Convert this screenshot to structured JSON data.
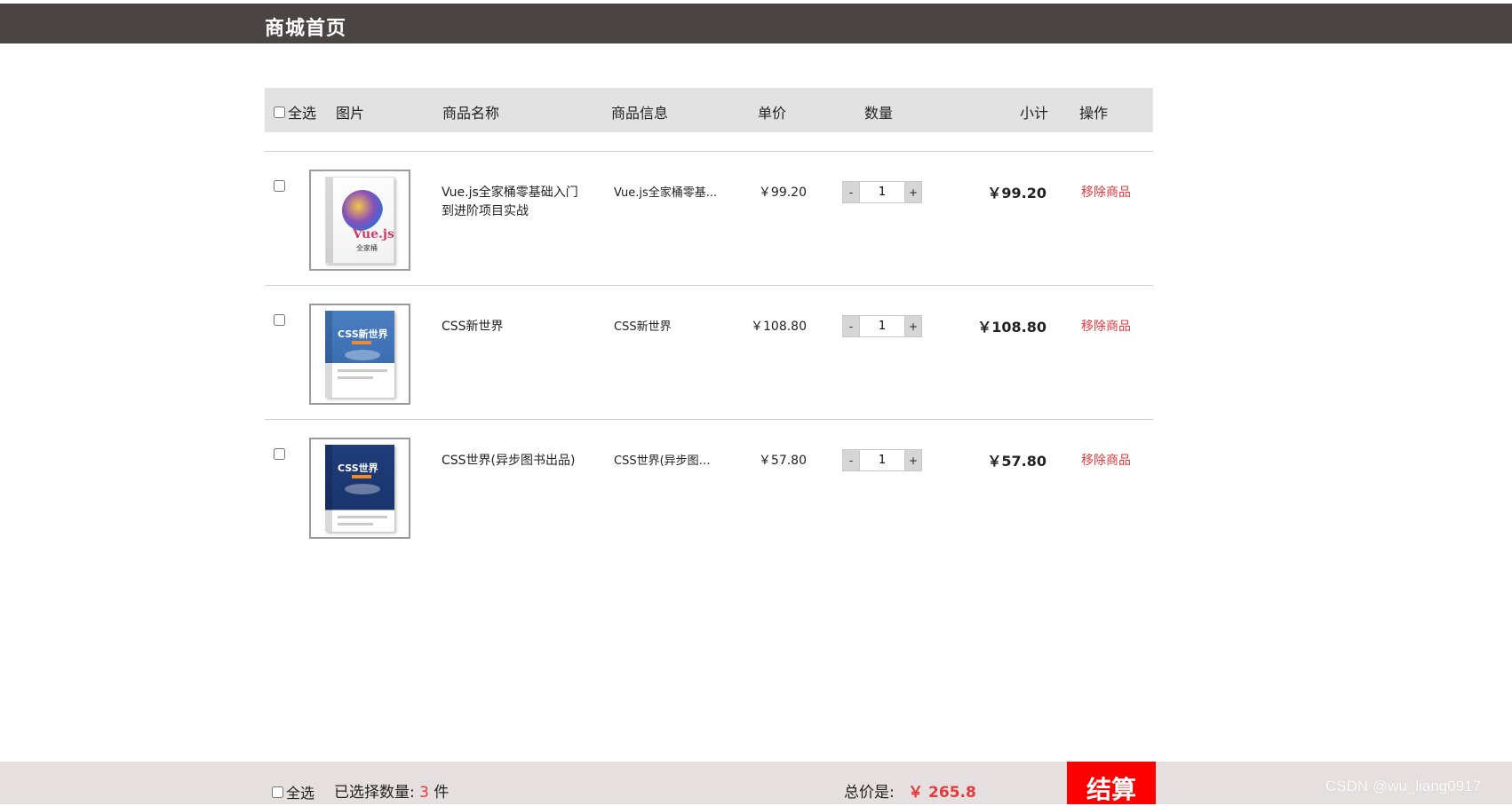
{
  "header": {
    "title": "商城首页"
  },
  "table": {
    "select_all": "全选",
    "columns": {
      "image": "图片",
      "name": "商品名称",
      "info": "商品信息",
      "price": "单价",
      "quantity": "数量",
      "subtotal": "小计",
      "operation": "操作"
    },
    "rows": [
      {
        "name": "Vue.js全家桶零基础入门到进阶项目实战",
        "info": "Vue.js全家桶零基...",
        "price": "￥99.20",
        "qty_minus": "-",
        "quantity": "1",
        "qty_plus": "+",
        "subtotal": "￥99.20",
        "remove": "移除商品",
        "cover_icon": "vue-book-cover",
        "cover_text": "Vue.js",
        "cover_sub": "全家桶"
      },
      {
        "name": "CSS新世界",
        "info": "CSS新世界",
        "price": "￥108.80",
        "qty_minus": "-",
        "quantity": "1",
        "qty_plus": "+",
        "subtotal": "￥108.80",
        "remove": "移除商品",
        "cover_icon": "css-new-world-book-cover",
        "cover_text": "CSS新世界"
      },
      {
        "name": "CSS世界(异步图书出品)",
        "info": "CSS世界(异步图书...",
        "price": "￥57.80",
        "qty_minus": "-",
        "quantity": "1",
        "qty_plus": "+",
        "subtotal": "￥57.80",
        "remove": "移除商品",
        "cover_icon": "css-world-book-cover",
        "cover_text": "CSS世界"
      }
    ]
  },
  "footer": {
    "select_all": "全选",
    "selected_label": "已选择数量:",
    "selected_count": "3",
    "selected_unit": "件",
    "total_label": "总价是:",
    "total_amount": "￥ 265.8",
    "checkout": "结算",
    "watermark": "CSDN @wu_liang0917"
  },
  "colors": {
    "header_bg": "#4a4443",
    "accent_red": "#e4393c",
    "checkout_bg": "#ff0000",
    "table_header_bg": "#e2e2e2",
    "footer_bg": "#e6dfdf"
  }
}
